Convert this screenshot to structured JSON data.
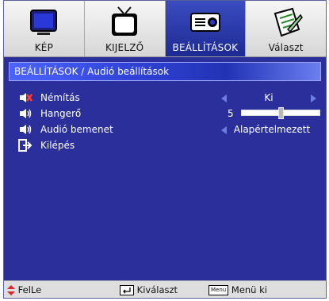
{
  "tabs": [
    {
      "label": "KÉP",
      "icon": "monitor-icon"
    },
    {
      "label": "KIJELZŐ",
      "icon": "tv-icon"
    },
    {
      "label": "BEÁLLÍTÁSOK",
      "icon": "projector-icon",
      "active": true
    },
    {
      "label": "Választ",
      "icon": "notepad-icon"
    }
  ],
  "breadcrumb": "BEÁLLÍTÁSOK / Audió beállítások",
  "items": {
    "mute": {
      "label": "Némítás",
      "value": "Ki",
      "icon": "speaker-muted-icon"
    },
    "volume": {
      "label": "Hangerő",
      "value": "5",
      "level": 0.5,
      "icon": "speaker-icon"
    },
    "audio_input": {
      "label": "Audió bemenet",
      "value": "Alapértelmezett",
      "icon": "speaker-icon"
    },
    "exit": {
      "label": "Kilépés",
      "icon": "exit-icon"
    }
  },
  "footer": {
    "nav": "FelLe",
    "select": "Kiválaszt",
    "menu_key": "Menu",
    "menu_label": "Menü ki"
  },
  "colors": {
    "background": "#2b2f9c",
    "band": "#3042d6",
    "arrow": "#6f7fe0"
  }
}
